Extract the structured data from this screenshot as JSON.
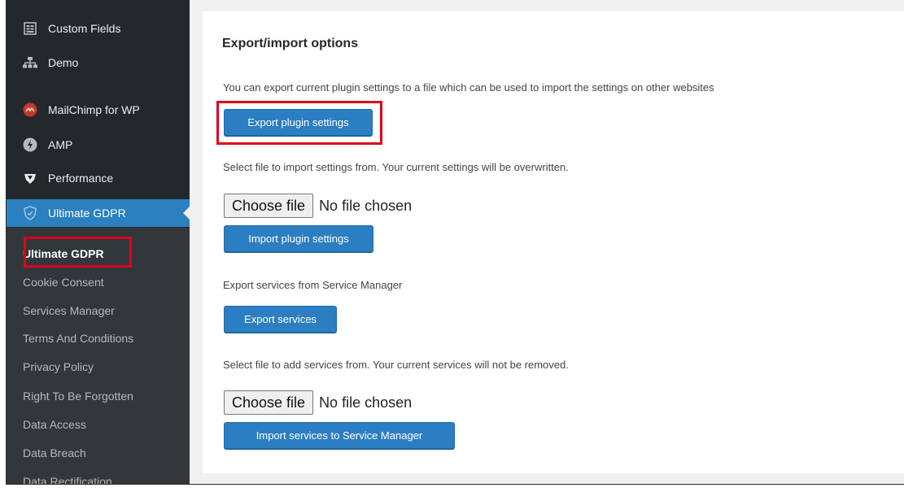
{
  "sidebar": {
    "items": [
      {
        "label": "Custom Fields",
        "icon": "custom-fields-icon"
      },
      {
        "label": "Demo",
        "icon": "sitemap-icon"
      },
      {
        "label": "MailChimp for WP",
        "icon": "mailchimp-icon"
      },
      {
        "label": "AMP",
        "icon": "amp-icon"
      },
      {
        "label": "Performance",
        "icon": "performance-icon"
      },
      {
        "label": "Ultimate GDPR",
        "icon": "shield-icon"
      }
    ],
    "submenu": [
      "Ultimate GDPR",
      "Cookie Consent",
      "Services Manager",
      "Terms And Conditions",
      "Privacy Policy",
      "Right To Be Forgotten",
      "Data Access",
      "Data Breach",
      "Data Rectification"
    ]
  },
  "main": {
    "heading": "Export/import options",
    "export_desc": "You can export current plugin settings to a file which can be used to import the settings on other websites",
    "export_button": "Export plugin settings",
    "import_desc": "Select file to import settings from. Your current settings will be overwritten.",
    "choose_file": "Choose file",
    "no_file": "No file chosen",
    "import_button": "Import plugin settings",
    "services_export_desc": "Export services from Service Manager",
    "services_export_button": "Export services",
    "services_import_desc": "Select file to add services from. Your current services will not be removed.",
    "services_import_button": "Import services to Service Manager"
  },
  "colors": {
    "sidebar_bg": "#23282d",
    "active_bg": "#2b80c0",
    "button_bg": "#2b7ec1",
    "highlight": "#e0001b"
  }
}
